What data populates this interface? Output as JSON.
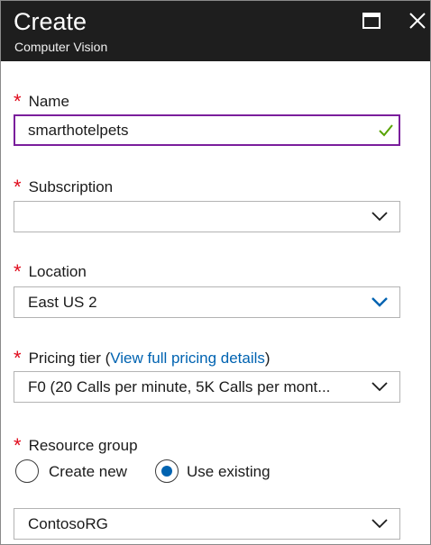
{
  "header": {
    "title": "Create",
    "subtitle": "Computer Vision"
  },
  "fields": {
    "name": {
      "label": "Name",
      "value": "smarthotelpets"
    },
    "subscription": {
      "label": "Subscription",
      "value": ""
    },
    "location": {
      "label": "Location",
      "value": "East US 2"
    },
    "pricing_tier": {
      "label": "Pricing tier (",
      "link": "View full pricing details",
      "label_end": ")",
      "value": "F0 (20 Calls per minute, 5K Calls per mont..."
    },
    "resource_group": {
      "label": "Resource group",
      "options": [
        "Create new",
        "Use existing"
      ],
      "selected": "Use existing",
      "value": "ContosoRG"
    }
  },
  "required_marker": "*",
  "colors": {
    "header_bg": "#1e1e1e",
    "required": "#e00b1c",
    "link": "#0063b1",
    "focus_border": "#7a1e9c",
    "valid_check": "#57a300",
    "radio_selected": "#0063b1"
  },
  "icons": [
    "maximize-icon",
    "close-icon",
    "checkmark-icon",
    "chevron-down-icon"
  ]
}
